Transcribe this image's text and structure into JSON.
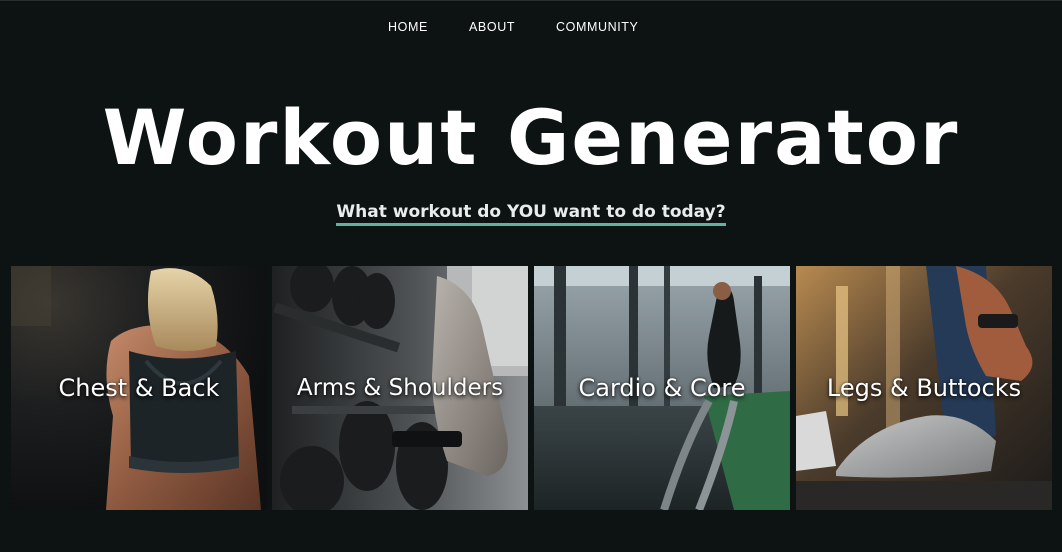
{
  "nav": {
    "items": [
      {
        "label": "HOME"
      },
      {
        "label": "ABOUT"
      },
      {
        "label": "COMMUNITY"
      }
    ]
  },
  "hero": {
    "title": "Workout Generator",
    "subtitle": "What workout do YOU want to do today?"
  },
  "categories": [
    {
      "label": "Chest & Back",
      "image": "woman-back-sports-bra-photo"
    },
    {
      "label": "Arms & Shoulders",
      "image": "dumbbell-rack-photo"
    },
    {
      "label": "Cardio & Core",
      "image": "battle-ropes-photo"
    },
    {
      "label": "Legs & Buttocks",
      "image": "tying-sneaker-photo"
    }
  ],
  "colors": {
    "background": "#0d1212",
    "accent_underline": "#5fb3a3",
    "text": "#ffffff"
  }
}
